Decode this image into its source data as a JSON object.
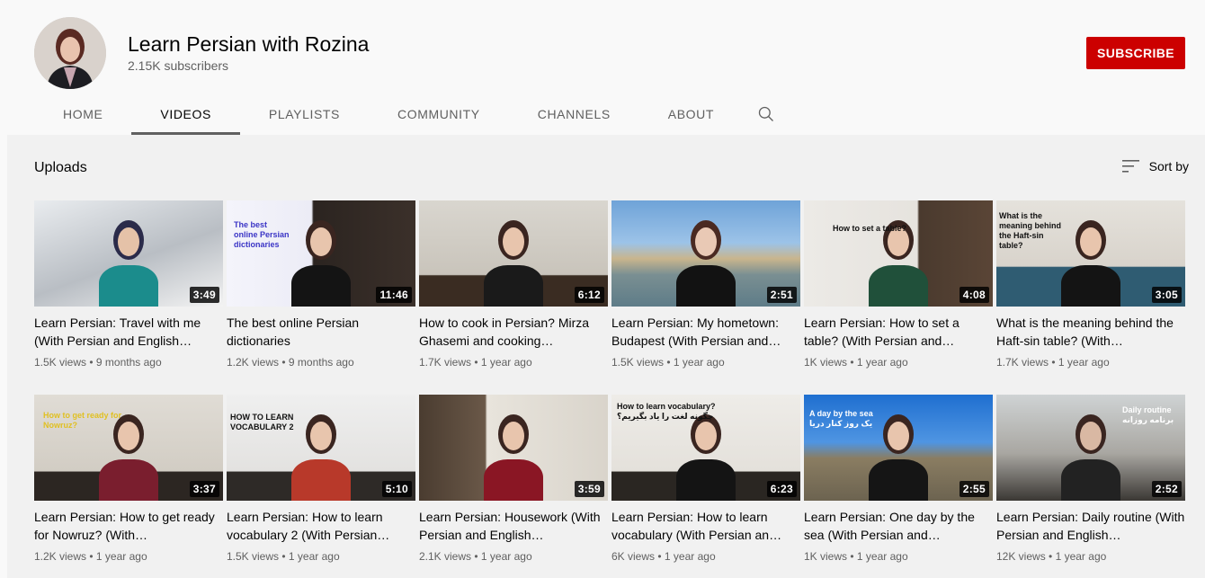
{
  "channel": {
    "name": "Learn Persian with Rozina",
    "subscribers": "2.15K subscribers",
    "subscribe_label": "SUBSCRIBE"
  },
  "tabs": [
    {
      "label": "HOME",
      "active": false
    },
    {
      "label": "VIDEOS",
      "active": true
    },
    {
      "label": "PLAYLISTS",
      "active": false
    },
    {
      "label": "COMMUNITY",
      "active": false
    },
    {
      "label": "CHANNELS",
      "active": false
    },
    {
      "label": "ABOUT",
      "active": false
    }
  ],
  "search_icon": "search-icon",
  "section": {
    "title": "Uploads",
    "sort_label": "Sort by",
    "sort_icon": "sort-icon"
  },
  "videos": [
    {
      "title": "Learn Persian: Travel with me (With Persian and English…",
      "duration": "3:49",
      "views": "1.5K views",
      "age": "9 months ago",
      "thumb_text": ""
    },
    {
      "title": "The best online Persian dictionaries",
      "duration": "11:46",
      "views": "1.2K views",
      "age": "9 months ago",
      "thumb_text": "The best\nonline Persian\ndictionaries"
    },
    {
      "title": "How to cook in Persian? Mirza Ghasemi and cooking…",
      "duration": "6:12",
      "views": "1.7K views",
      "age": "1 year ago",
      "thumb_text": ""
    },
    {
      "title": "Learn Persian: My hometown: Budapest (With Persian and…",
      "duration": "2:51",
      "views": "1.5K views",
      "age": "1 year ago",
      "thumb_text": ""
    },
    {
      "title": "Learn Persian: How to set a table? (With Persian and…",
      "duration": "4:08",
      "views": "1K views",
      "age": "1 year ago",
      "thumb_text": "How to set a table?"
    },
    {
      "title": "What is the meaning behind the Haft-sin table? (With…",
      "duration": "3:05",
      "views": "1.7K views",
      "age": "1 year ago",
      "thumb_text": "What is the\nmeaning behind\nthe Haft-sin\ntable?"
    },
    {
      "title": "Learn Persian: How to get ready for Nowruz? (With…",
      "duration": "3:37",
      "views": "1.2K views",
      "age": "1 year ago",
      "thumb_text": "How to get ready for\nNowruz?"
    },
    {
      "title": "Learn Persian: How to learn vocabulary 2 (With Persian…",
      "duration": "5:10",
      "views": "1.5K views",
      "age": "1 year ago",
      "thumb_text": "HOW TO LEARN\nVOCABULARY 2"
    },
    {
      "title": "Learn Persian: Housework (With Persian and English…",
      "duration": "3:59",
      "views": "2.1K views",
      "age": "1 year ago",
      "thumb_text": ""
    },
    {
      "title": "Learn Persian: How to learn vocabulary (With Persian an…",
      "duration": "6:23",
      "views": "6K views",
      "age": "1 year ago",
      "thumb_text": "How to learn vocabulary?\nچگونه لغت را یاد بگیریم؟"
    },
    {
      "title": "Learn Persian: One day by the sea (With Persian and…",
      "duration": "2:55",
      "views": "1K views",
      "age": "1 year ago",
      "thumb_text": "A day by the sea\nیک روز کنار دریا"
    },
    {
      "title": "Learn Persian: Daily routine (With Persian and English…",
      "duration": "2:52",
      "views": "12K views",
      "age": "1 year ago",
      "thumb_text": "Daily routine\nبرنامه روزانه"
    }
  ]
}
